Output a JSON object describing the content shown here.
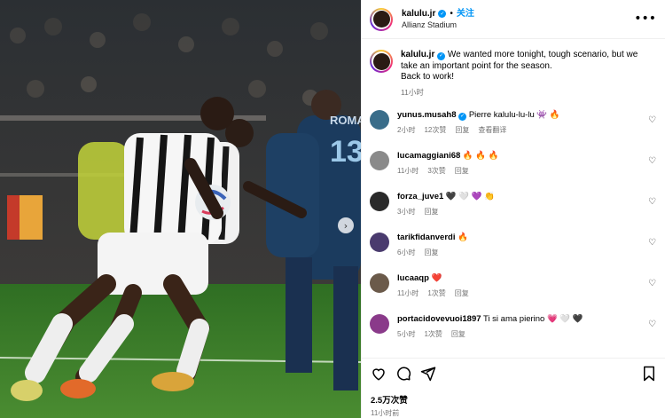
{
  "post": {
    "username": "kalulu.jr",
    "follow_label": "关注",
    "separator": "•",
    "location": "Allianz Stadium",
    "more_icon": "more-horizontal-icon",
    "verified_icon": "verified-badge-icon"
  },
  "caption": {
    "username": "kalulu.jr",
    "text": "We wanted more tonight, tough scenario, but we take an important point for the season.",
    "text2": "Back to work!",
    "time": "11小时"
  },
  "comments": [
    {
      "username": "yunus.musah8",
      "verified": true,
      "text": "Pierre kalulu-lu-lu 👾 🔥",
      "time": "2小时",
      "likes": "12次赞",
      "reply": "回复",
      "translate": "查看翻译",
      "avatar_color": "#3a6d8a"
    },
    {
      "username": "lucamaggiani68",
      "verified": false,
      "text": "🔥 🔥 🔥",
      "time": "11小时",
      "likes": "3次赞",
      "reply": "回复",
      "translate": "",
      "avatar_color": "#8a8a8a"
    },
    {
      "username": "forza_juve1",
      "verified": false,
      "text": "🖤 🤍 💜 👏",
      "time": "3小时",
      "likes": "",
      "reply": "回复",
      "translate": "",
      "avatar_color": "#2a2a2a"
    },
    {
      "username": "tarikfidanverdi",
      "verified": false,
      "text": "🔥",
      "time": "6小时",
      "likes": "",
      "reply": "回复",
      "translate": "",
      "avatar_color": "#4a3b6e"
    },
    {
      "username": "lucaaqp",
      "verified": false,
      "text": "❤️",
      "time": "11小时",
      "likes": "1次赞",
      "reply": "回复",
      "translate": "",
      "avatar_color": "#6b5a4a"
    },
    {
      "username": "portacidovevuoi1897",
      "verified": false,
      "text": "Ti si ama pierino 💗 🤍 🖤",
      "time": "5小时",
      "likes": "1次赞",
      "reply": "回复",
      "translate": "",
      "avatar_color": "#8a3a8a"
    }
  ],
  "actions": {
    "like_icon": "heart-icon",
    "comment_icon": "comment-icon",
    "share_icon": "send-icon",
    "save_icon": "bookmark-icon"
  },
  "likes_count": "2.5万次赞",
  "post_time": "11小时前",
  "photo": {
    "jersey_number": "13",
    "jersey_text": "ROMA",
    "carousel_next_icon": "chevron-right-icon"
  },
  "colors": {
    "accent": "#0095f6",
    "muted": "#737373",
    "pitch": "#3a7a2a"
  }
}
